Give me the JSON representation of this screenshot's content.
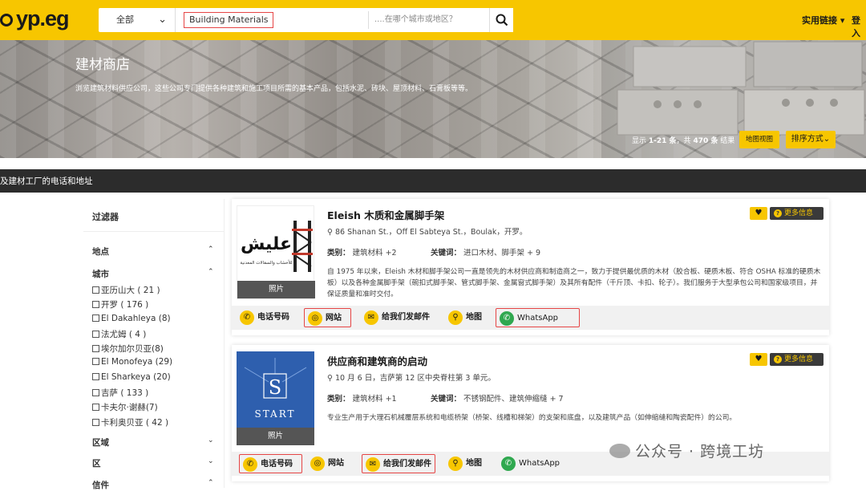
{
  "header": {
    "logo": "yp.eg",
    "category": "全部",
    "keyword": "Building Materials",
    "location_placeholder": "....在哪个城市或地区？",
    "links": "实用链接",
    "login": "登入"
  },
  "hero": {
    "title": "建材商店",
    "subtitle": "浏览建筑材料供应公司，这些公司专门提供各种建筑和施工项目所需的基本产品，包括水泥、砖块、屋顶材料、石膏板等等。",
    "count_prefix": "显示",
    "count_range": "1-21 条",
    "count_mid": "，共",
    "count_total": "470 条",
    "count_suffix": "结果",
    "map_button": "地图视图",
    "sort_button": "排序方式"
  },
  "strip": {
    "text": "及建材工厂的电话和地址"
  },
  "filters": {
    "title": "过滤器",
    "location": "地点",
    "city_heading": "城市",
    "cities": [
      "亚历山大 ( 21 )",
      "开罗 ( 176 )",
      "El Dakahleya (8)",
      "法尤姆 ( 4 )",
      "埃尔加尔贝亚(8)",
      "El Monofeya (29)",
      "El Sharkeya (20)",
      "吉萨 ( 133 )",
      "卡夫尔·谢赫(7)",
      "卡利奥贝亚 ( 42 )"
    ],
    "region": "区域",
    "district": "区",
    "credit": "信件"
  },
  "listings": [
    {
      "title": "Eleish 木质和金属脚手架",
      "address": "86 Shanan St.，Off El Sabteya St.，Boulak，开罗。",
      "category_label": "类别：",
      "category_value": "建筑材料 +2",
      "keyword_label": "关键词：",
      "keyword_value": "进口木材、脚手架 + 9",
      "description": "自 1975 年以来，Eleish 木材和脚手架公司一直是领先的木材供应商和制造商之一，致力于提供最优质的木材（胶合板、硬质木板、符合 OSHA 标准的硬质木板）以及各种金属脚手架（碗扣式脚手架、管式脚手架、金属窗式脚手架）及其所有配件（千斤顶、卡扣、轮子）。我们服务于大型承包公司和国家级项目，并保证质量和准时交付。",
      "photo": "照片",
      "more": "更多信息",
      "logo_text": "عليش",
      "logo_caption": "للأخشاب والسقالات المعدنية"
    },
    {
      "title": "供应商和建筑商的启动",
      "address": "10 月 6 日，吉萨第 12 区中央脊柱第 3 单元。",
      "category_label": "类别：",
      "category_value": "建筑材料 +1",
      "keyword_label": "关键词：",
      "keyword_value": "不锈钢配件、建筑伸缩缝 + 7",
      "description": "专业生产用于大理石机械覆层系统和电缆桥架（桥架、线槽和梯架）的支架和底盘，以及建筑产品（如伸缩缝和陶瓷配件）的公司。",
      "photo": "照片",
      "more": "更多信息",
      "logo_letter": "S",
      "logo_word": "START"
    }
  ],
  "actions": {
    "phone": "电话号码",
    "website": "网站",
    "email": "给我们发邮件",
    "map": "地图",
    "whatsapp": "WhatsApp"
  },
  "watermark": "公众号 · 跨境工坊",
  "colors": {
    "brand": "#f7c600",
    "highlight": "#e64545",
    "dark": "#2c2c2c",
    "whatsapp": "#2fa84f"
  }
}
